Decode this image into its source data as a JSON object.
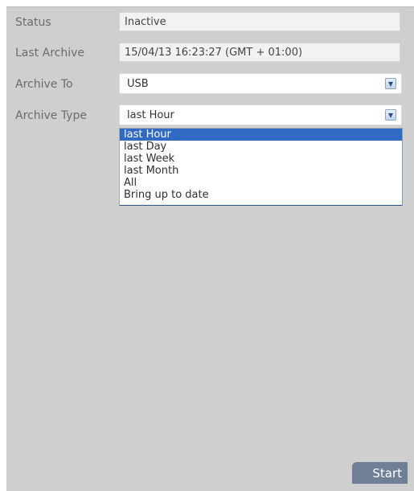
{
  "form": {
    "status": {
      "label": "Status",
      "value": "Inactive"
    },
    "last_archive": {
      "label": "Last Archive",
      "value": "15/04/13 16:23:27 (GMT + 01:00)"
    },
    "archive_to": {
      "label": "Archive To",
      "value": "USB"
    },
    "archive_type": {
      "label": "Archive Type",
      "value": "last Hour",
      "options": [
        "last Hour",
        "last Day",
        "last Week",
        "last Month",
        "All",
        "Bring up to date"
      ],
      "selected_index": 0
    }
  },
  "buttons": {
    "start_label": "Start"
  },
  "icons": {
    "dropdown": "chevron-down-icon"
  }
}
